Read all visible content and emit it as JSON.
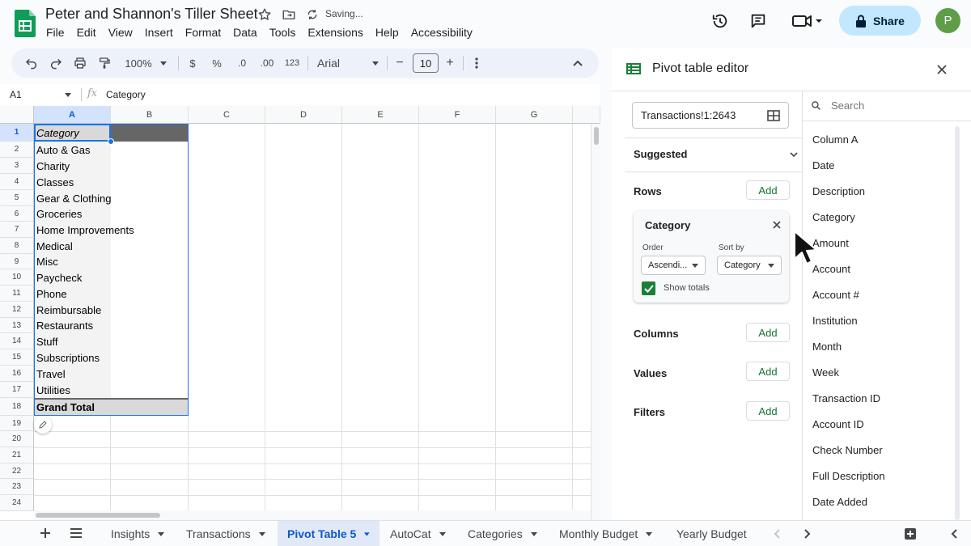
{
  "header": {
    "title": "Peter and Shannon's Tiller Sheet",
    "saving_status": "Saving...",
    "menu": [
      "File",
      "Edit",
      "View",
      "Insert",
      "Format",
      "Data",
      "Tools",
      "Extensions",
      "Help",
      "Accessibility"
    ],
    "share_label": "Share",
    "avatar_initial": "P"
  },
  "toolbar": {
    "zoom": "100%",
    "currency": "$",
    "percent": "%",
    "decrease_decimal": ".0",
    "increase_decimal": ".00",
    "more_formats": "123",
    "font": "Arial",
    "font_size": "10",
    "minus": "−",
    "plus": "+"
  },
  "formula_bar": {
    "cell_ref": "A1",
    "fx": "fx",
    "content": "Category"
  },
  "grid": {
    "columns": [
      "A",
      "B",
      "C",
      "D",
      "E",
      "F",
      "G"
    ],
    "rows": [
      "1",
      "2",
      "3",
      "4",
      "5",
      "6",
      "7",
      "8",
      "9",
      "10",
      "11",
      "12",
      "13",
      "14",
      "15",
      "16",
      "17",
      "18",
      "19",
      "20",
      "21",
      "22",
      "23",
      "24"
    ],
    "cells_a": [
      "Category",
      "Auto & Gas",
      "Charity",
      "Classes",
      "Gear & Clothing",
      "Groceries",
      "Home Improvements",
      "Medical",
      "Misc",
      "Paycheck",
      "Phone",
      "Reimbursable",
      "Restaurants",
      "Stuff",
      "Subscriptions",
      "Travel",
      "Utilities",
      "Grand Total"
    ]
  },
  "sheet_tabs": [
    "Insights",
    "Transactions",
    "Pivot Table 5",
    "AutoCat",
    "Categories",
    "Monthly Budget",
    "Yearly Budget"
  ],
  "active_tab": "Pivot Table 5",
  "pivot_editor": {
    "title": "Pivot table editor",
    "range": "Transactions!1:2643",
    "suggested": "Suggested",
    "rows_label": "Rows",
    "columns_label": "Columns",
    "values_label": "Values",
    "filters_label": "Filters",
    "add_label": "Add",
    "row_card": {
      "title": "Category",
      "order_label": "Order",
      "order_value": "Ascendi...",
      "sort_label": "Sort by",
      "sort_value": "Category",
      "show_totals": "Show totals"
    },
    "search_placeholder": "Search",
    "fields": [
      "Column A",
      "Date",
      "Description",
      "Category",
      "Amount",
      "Account",
      "Account #",
      "Institution",
      "Month",
      "Week",
      "Transaction ID",
      "Account ID",
      "Check Number",
      "Full Description",
      "Date Added"
    ]
  },
  "colors": {
    "accent": "#0b57d0",
    "share_bg": "#c2e7ff",
    "add_text": "#137333",
    "sheets_green": "#0f9d58",
    "header_gray": "#666666"
  }
}
